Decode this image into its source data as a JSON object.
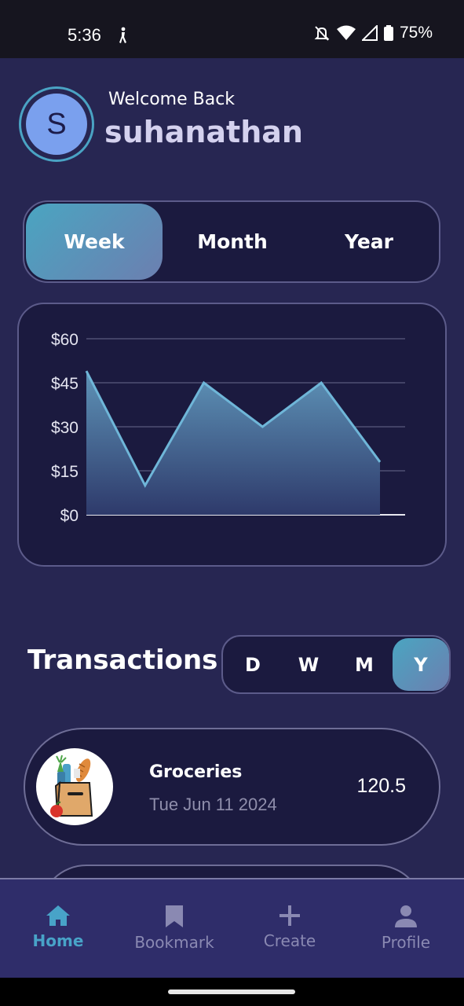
{
  "status_bar": {
    "time": "5:36",
    "battery": "75%"
  },
  "header": {
    "avatar_initial": "S",
    "welcome": "Welcome Back",
    "username": "suhanathan"
  },
  "period_tabs": {
    "items": [
      "Week",
      "Month",
      "Year"
    ],
    "selected": "Week"
  },
  "chart_data": {
    "type": "area",
    "y_ticks": [
      "$60",
      "$45",
      "$30",
      "$15",
      "$0"
    ],
    "ylim": [
      0,
      60
    ],
    "values": [
      49,
      10,
      45,
      30,
      45,
      18
    ],
    "line_color": "#6fb6d8",
    "fill_top_color": "#5e93b7",
    "fill_bottom_color": "#2e3a6b",
    "grid": true
  },
  "transactions": {
    "title": "Transactions",
    "range_options": [
      "D",
      "W",
      "M",
      "Y"
    ],
    "selected_range": "Y",
    "items": [
      {
        "name": "Groceries",
        "date": "Tue Jun 11 2024",
        "amount": "120.5",
        "icon": "grocery-bag-icon"
      }
    ]
  },
  "bottom_nav": {
    "items": [
      {
        "label": "Home",
        "icon": "home-icon"
      },
      {
        "label": "Bookmark",
        "icon": "bookmark-icon"
      },
      {
        "label": "Create",
        "icon": "plus-icon"
      },
      {
        "label": "Profile",
        "icon": "person-icon"
      }
    ],
    "active": "Home"
  },
  "colors": {
    "background": "#272652",
    "card": "#1b1a3f",
    "accent": "#48a3c8"
  }
}
